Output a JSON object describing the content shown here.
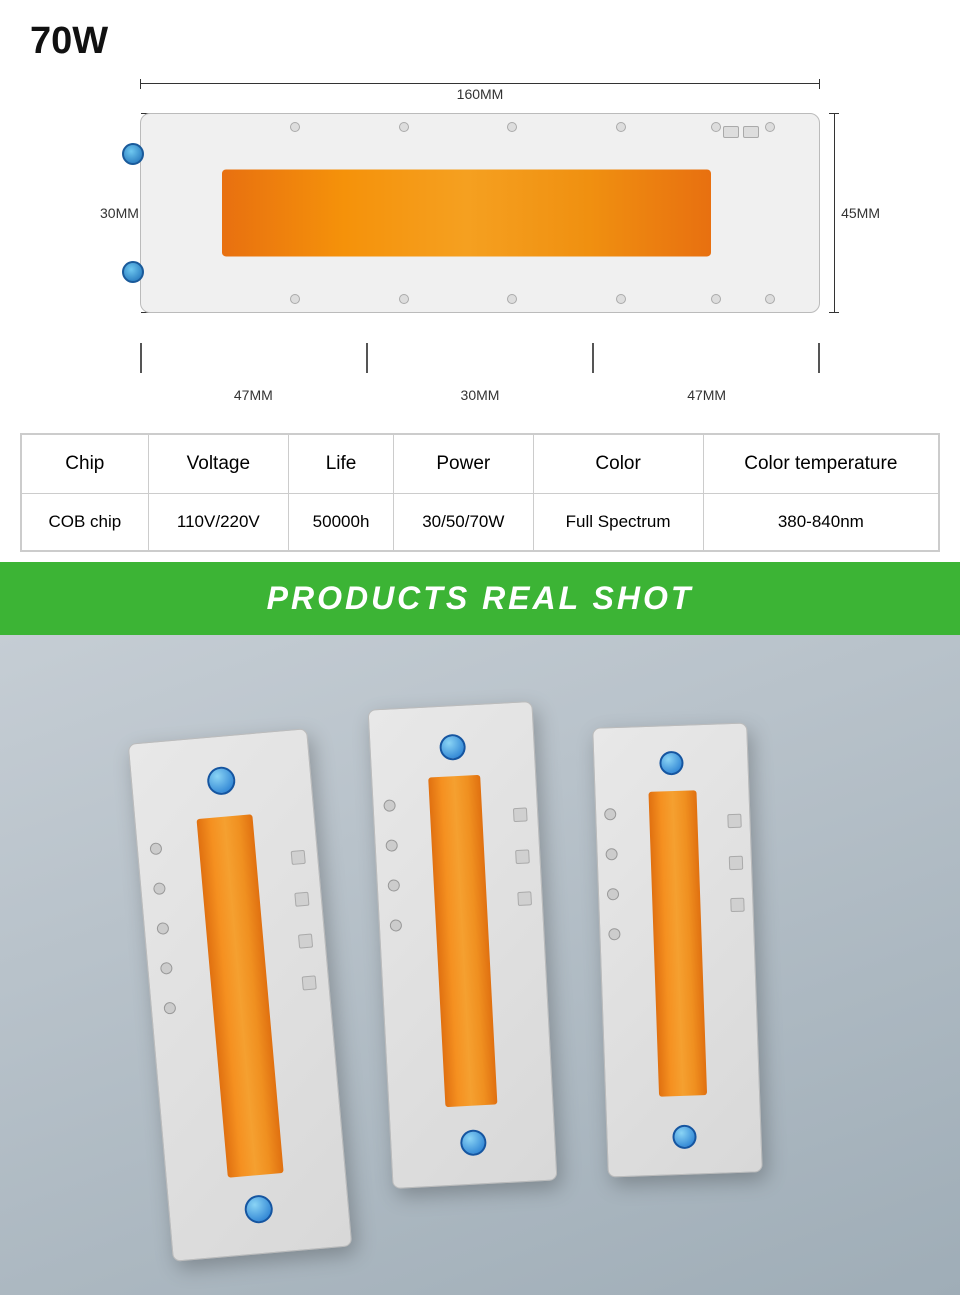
{
  "title": "70W",
  "diagram": {
    "width_label": "160MM",
    "height_label_left": "30MM",
    "height_label_right": "45MM",
    "bottom_dims": [
      "47MM",
      "30MM",
      "47MM"
    ]
  },
  "table": {
    "headers": [
      "Chip",
      "Voltage",
      "Life",
      "Power",
      "Color",
      "Color temperature"
    ],
    "row": [
      "COB chip",
      "110V/220V",
      "50000h",
      "30/50/70W",
      "Full Spectrum",
      "380-840nm"
    ]
  },
  "banner": {
    "text": "PRODUCTS REAL SHOT"
  },
  "photo": {
    "alt": "Three LED COB chip boards photographed on grey background"
  }
}
